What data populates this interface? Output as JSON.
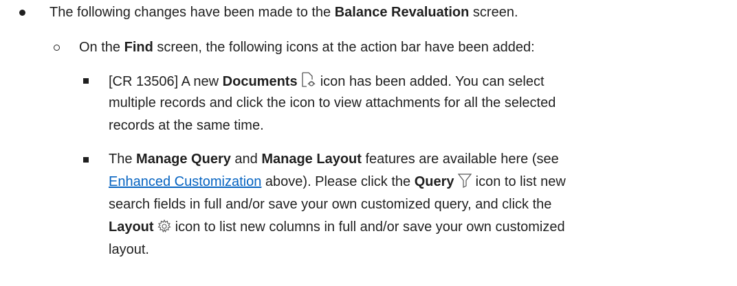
{
  "level1": {
    "prefix": "The following changes have been made to the ",
    "bold": "Balance Revaluation",
    "suffix": " screen."
  },
  "level2": {
    "prefix": "On the ",
    "bold": "Find",
    "suffix": " screen, the following icons at the action bar have been added:"
  },
  "item1": {
    "l1_a": "[CR 13506] A new ",
    "l1_bold": "Documents",
    "l1_b": " icon has been added. You can select",
    "l2": "multiple records and click the icon to view attachments for all the selected",
    "l3": "records at the same time."
  },
  "item2": {
    "l1_a": "The ",
    "l1_bold1": "Manage Query",
    "l1_b": " and ",
    "l1_bold2": "Manage Layout",
    "l1_c": " features are available here (see",
    "l2_link": "Enhanced Customization",
    "l2_a": " above). Please click the ",
    "l2_bold": "Query",
    "l2_b": " icon to list new",
    "l3": "search fields in full and/or save your own customized query, and click the",
    "l4_bold": "Layout",
    "l4_a": " icon to list new columns in full and/or save your own customized",
    "l5": "layout."
  },
  "icons": [
    "documents-icon",
    "filter-icon",
    "gear-icon"
  ]
}
